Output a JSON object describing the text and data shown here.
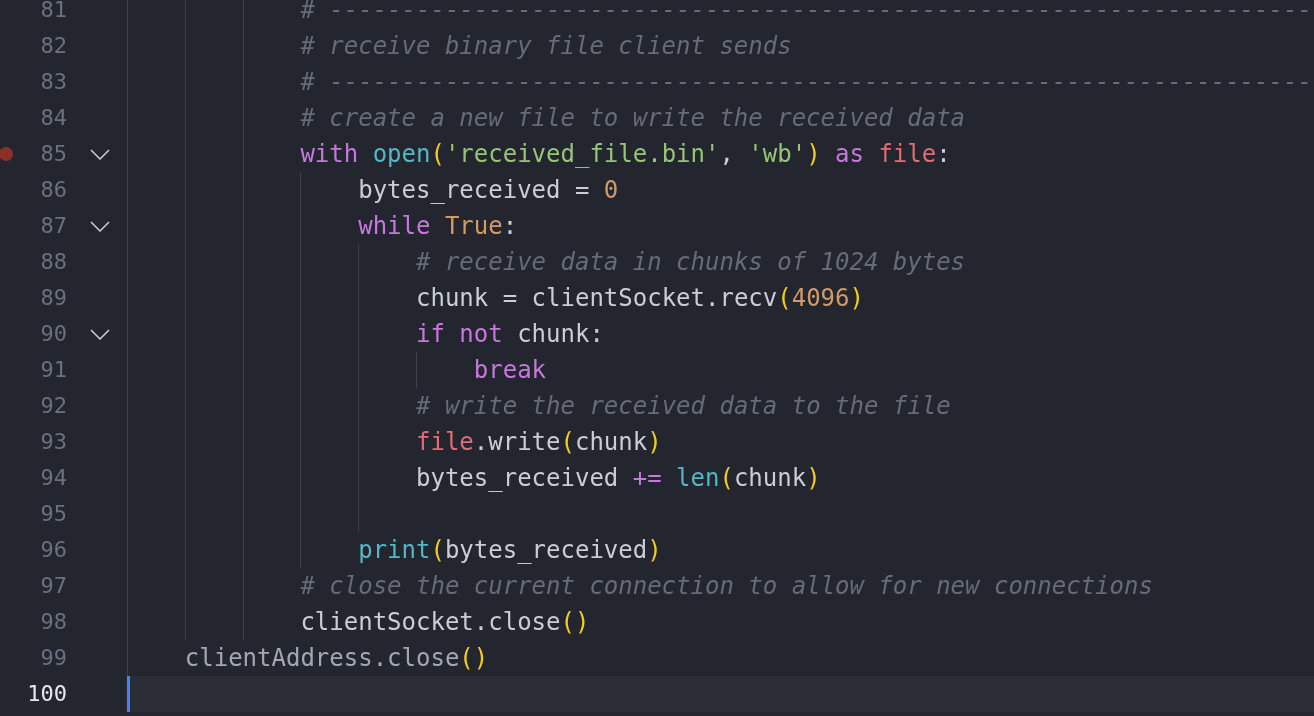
{
  "editor": {
    "lines": [
      {
        "kind": "scope",
        "children": [
          {
            "kind": "scope",
            "children": [
              {
                "kind": "scope",
                "children": [
                  {
                    "kind": "line",
                    "number": "81",
                    "breakpoint": false,
                    "fold": false,
                    "current": false,
                    "tokens": [
                      {
                        "text": "# --------------------------------------------------------------------",
                        "kind": "comment"
                      }
                    ]
                  },
                  {
                    "kind": "line",
                    "number": "82",
                    "breakpoint": false,
                    "fold": false,
                    "current": false,
                    "tokens": [
                      {
                        "text": "# receive binary file client sends",
                        "kind": "comment"
                      }
                    ]
                  },
                  {
                    "kind": "line",
                    "number": "83",
                    "breakpoint": false,
                    "fold": false,
                    "current": false,
                    "tokens": [
                      {
                        "text": "# --------------------------------------------------------------------",
                        "kind": "comment"
                      }
                    ]
                  },
                  {
                    "kind": "line",
                    "number": "84",
                    "breakpoint": false,
                    "fold": false,
                    "current": false,
                    "tokens": [
                      {
                        "text": "# create a new file to write the received data",
                        "kind": "comment"
                      }
                    ]
                  },
                  {
                    "kind": "line",
                    "number": "85",
                    "breakpoint": true,
                    "fold": true,
                    "current": false,
                    "tokens": [
                      {
                        "text": "with ",
                        "kind": "keyword"
                      },
                      {
                        "text": "open",
                        "kind": "function"
                      },
                      {
                        "text": "(",
                        "kind": "paren"
                      },
                      {
                        "text": "'received_file.bin'",
                        "kind": "string"
                      },
                      {
                        "text": ", ",
                        "kind": "plain"
                      },
                      {
                        "text": "'wb'",
                        "kind": "string"
                      },
                      {
                        "text": ")",
                        "kind": "paren"
                      },
                      {
                        "text": " as ",
                        "kind": "keyword"
                      },
                      {
                        "text": "file",
                        "kind": "variable"
                      },
                      {
                        "text": ":",
                        "kind": "plain"
                      }
                    ],
                    "children": [
                      {
                        "kind": "line",
                        "number": "86",
                        "breakpoint": false,
                        "fold": false,
                        "current": false,
                        "tokens": [
                          {
                            "text": "bytes_received = ",
                            "kind": "plain"
                          },
                          {
                            "text": "0",
                            "kind": "number"
                          }
                        ]
                      },
                      {
                        "kind": "line",
                        "number": "87",
                        "breakpoint": false,
                        "fold": true,
                        "current": false,
                        "tokens": [
                          {
                            "text": "while ",
                            "kind": "keyword"
                          },
                          {
                            "text": "True",
                            "kind": "number"
                          },
                          {
                            "text": ":",
                            "kind": "plain"
                          }
                        ],
                        "children": [
                          {
                            "kind": "line",
                            "number": "88",
                            "breakpoint": false,
                            "fold": false,
                            "current": false,
                            "tokens": [
                              {
                                "text": "# receive data in chunks of 1024 bytes",
                                "kind": "comment"
                              }
                            ]
                          },
                          {
                            "kind": "line",
                            "number": "89",
                            "breakpoint": false,
                            "fold": false,
                            "current": false,
                            "tokens": [
                              {
                                "text": "chunk = clientSocket.recv",
                                "kind": "plain"
                              },
                              {
                                "text": "(",
                                "kind": "paren"
                              },
                              {
                                "text": "4096",
                                "kind": "number"
                              },
                              {
                                "text": ")",
                                "kind": "paren"
                              }
                            ]
                          },
                          {
                            "kind": "line",
                            "number": "90",
                            "breakpoint": false,
                            "fold": true,
                            "current": false,
                            "tokens": [
                              {
                                "text": "if not",
                                "kind": "keyword"
                              },
                              {
                                "text": " chunk:",
                                "kind": "plain"
                              }
                            ],
                            "children": [
                              {
                                "kind": "line",
                                "number": "91",
                                "breakpoint": false,
                                "fold": false,
                                "current": false,
                                "tokens": [
                                  {
                                    "text": "break",
                                    "kind": "keyword"
                                  }
                                ]
                              }
                            ]
                          },
                          {
                            "kind": "line",
                            "number": "92",
                            "breakpoint": false,
                            "fold": false,
                            "current": false,
                            "tokens": [
                              {
                                "text": "# write the received data to the file",
                                "kind": "comment"
                              }
                            ]
                          },
                          {
                            "kind": "line",
                            "number": "93",
                            "breakpoint": false,
                            "fold": false,
                            "current": false,
                            "tokens": [
                              {
                                "text": "file",
                                "kind": "variable"
                              },
                              {
                                "text": ".write",
                                "kind": "plain"
                              },
                              {
                                "text": "(",
                                "kind": "paren"
                              },
                              {
                                "text": "chunk",
                                "kind": "plain"
                              },
                              {
                                "text": ")",
                                "kind": "paren"
                              }
                            ]
                          },
                          {
                            "kind": "line",
                            "number": "94",
                            "breakpoint": false,
                            "fold": false,
                            "current": false,
                            "tokens": [
                              {
                                "text": "bytes_received ",
                                "kind": "plain"
                              },
                              {
                                "text": "+= ",
                                "kind": "keyword"
                              },
                              {
                                "text": "len",
                                "kind": "function"
                              },
                              {
                                "text": "(",
                                "kind": "paren"
                              },
                              {
                                "text": "chunk",
                                "kind": "plain"
                              },
                              {
                                "text": ")",
                                "kind": "paren"
                              }
                            ]
                          },
                          {
                            "kind": "line",
                            "number": "95",
                            "breakpoint": false,
                            "fold": false,
                            "current": false
                          }
                        ]
                      },
                      {
                        "kind": "line",
                        "number": "96",
                        "breakpoint": false,
                        "fold": false,
                        "current": false,
                        "tokens": [
                          {
                            "text": "print",
                            "kind": "function"
                          },
                          {
                            "text": "(",
                            "kind": "paren"
                          },
                          {
                            "text": "bytes_received",
                            "kind": "plain"
                          },
                          {
                            "text": ")",
                            "kind": "paren"
                          }
                        ]
                      }
                    ]
                  },
                  {
                    "kind": "line",
                    "number": "97",
                    "breakpoint": false,
                    "fold": false,
                    "current": false,
                    "tokens": [
                      {
                        "text": "# close the current connection to allow for new connections",
                        "kind": "comment"
                      }
                    ]
                  },
                  {
                    "kind": "line",
                    "number": "98",
                    "breakpoint": false,
                    "fold": false,
                    "current": false,
                    "tokens": [
                      {
                        "text": "clientSocket.close",
                        "kind": "plain"
                      },
                      {
                        "text": "()",
                        "kind": "paren"
                      }
                    ]
                  }
                ]
              }
            ]
          },
          {
            "kind": "line",
            "number": "99",
            "breakpoint": false,
            "fold": false,
            "current": false,
            "tokens": [
              {
                "text": "clientAddress.close",
                "kind": "dim"
              },
              {
                "text": "()",
                "kind": "paren"
              }
            ]
          }
        ]
      },
      {
        "kind": "line",
        "number": "100",
        "breakpoint": false,
        "fold": false,
        "current": true
      }
    ]
  }
}
